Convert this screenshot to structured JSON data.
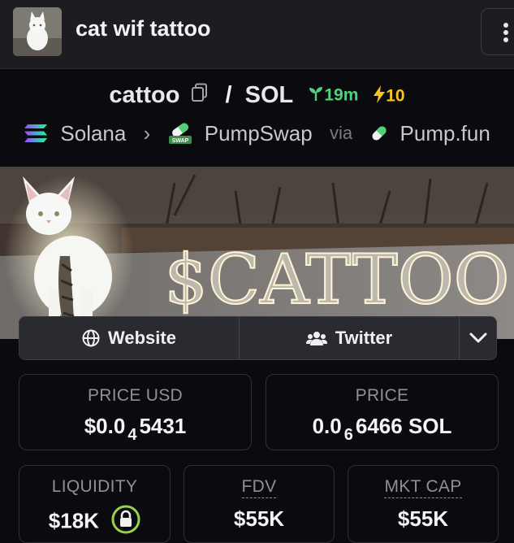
{
  "header": {
    "title": "cat wif tattoo"
  },
  "pair": {
    "base": "cattoo",
    "separator": "/",
    "quote": "SOL",
    "age": "19m",
    "boosts": "10"
  },
  "chain": {
    "network": "Solana",
    "dex": "PumpSwap",
    "via_label": "via",
    "launchpad": "Pump.fun"
  },
  "banner": {
    "text": "$CATTOO"
  },
  "links": {
    "website": "Website",
    "twitter": "Twitter"
  },
  "stats": {
    "price_usd": {
      "label": "PRICE USD",
      "prefix": "$0.0",
      "zeros": "4",
      "digits": "5431"
    },
    "price_native": {
      "label": "PRICE",
      "prefix": "0.0",
      "zeros": "6",
      "digits": "6466",
      "unit": "SOL"
    },
    "liquidity": {
      "label": "LIQUIDITY",
      "value": "$18K"
    },
    "fdv": {
      "label": "FDV",
      "value": "$55K"
    },
    "mkt_cap": {
      "label": "MKT CAP",
      "value": "$55K"
    }
  },
  "icons": [
    "cat-avatar-icon",
    "more-vertical-icon",
    "copy-icon",
    "seedling-icon",
    "bolt-icon",
    "solana-icon",
    "pumpswap-icon",
    "pill-icon",
    "globe-icon",
    "users-icon",
    "chevron-down-icon",
    "lock-icon"
  ],
  "colors": {
    "age_green": "#4fd27a",
    "boost_yellow": "#f5c518",
    "lock_green": "#9ad14b"
  }
}
